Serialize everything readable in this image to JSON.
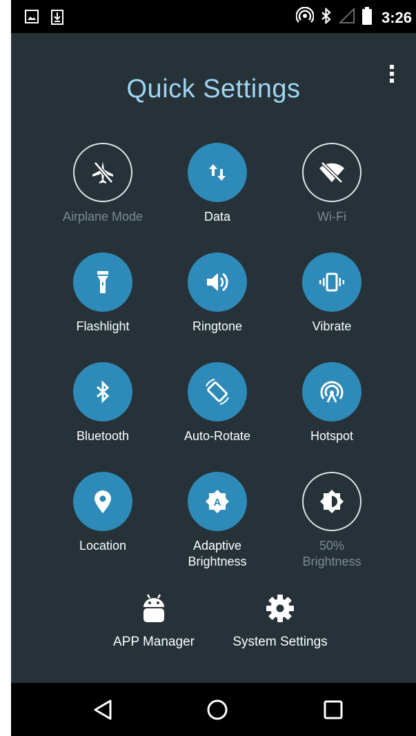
{
  "status_bar": {
    "time": "3:26",
    "icons": [
      "image-icon",
      "download-icon",
      "hotspot-icon",
      "bluetooth-icon",
      "signal-icon",
      "battery-icon"
    ]
  },
  "header": {
    "title": "Quick Settings"
  },
  "tiles": [
    {
      "label": "Airplane Mode",
      "icon": "airplane-icon",
      "state": "off"
    },
    {
      "label": "Data",
      "icon": "data-icon",
      "state": "on"
    },
    {
      "label": "Wi-Fi",
      "icon": "wifi-off-icon",
      "state": "off"
    },
    {
      "label": "Flashlight",
      "icon": "flashlight-icon",
      "state": "on"
    },
    {
      "label": "Ringtone",
      "icon": "volume-icon",
      "state": "on"
    },
    {
      "label": "Vibrate",
      "icon": "vibrate-icon",
      "state": "on"
    },
    {
      "label": "Bluetooth",
      "icon": "bluetooth-icon",
      "state": "on"
    },
    {
      "label": "Auto-Rotate",
      "icon": "rotate-icon",
      "state": "on"
    },
    {
      "label": "Hotspot",
      "icon": "hotspot-icon",
      "state": "on"
    },
    {
      "label": "Location",
      "icon": "location-icon",
      "state": "on"
    },
    {
      "label": "Adaptive\nBrightness",
      "icon": "auto-brightness-icon",
      "state": "on"
    },
    {
      "label": "50%\nBrightness",
      "icon": "brightness-icon",
      "state": "off"
    }
  ],
  "bottom": {
    "app_manager": "APP Manager",
    "system_settings": "System Settings"
  },
  "colors": {
    "background": "#263238",
    "accent": "#2e8ab8",
    "title": "#9fd6f2",
    "dim_label": "#7b8a92"
  }
}
